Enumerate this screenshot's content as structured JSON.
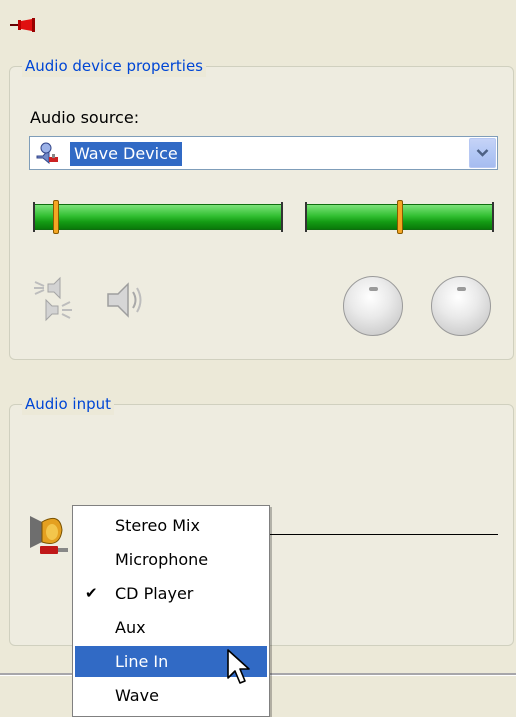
{
  "window": {
    "pin_icon": "pin-icon"
  },
  "properties": {
    "group_title": "Audio device properties",
    "source_label": "Audio source:",
    "source_value": "Wave Device",
    "source_icon": "audio-device-icon",
    "left_level": 0.08,
    "right_level": 0.5,
    "mute_icon": "speakers-icon",
    "volume_icon": "speaker-icon"
  },
  "input": {
    "group_title": "Audio input",
    "input_icon": "speaker-cable-icon"
  },
  "menu": {
    "items": [
      {
        "label": "Stereo Mix",
        "checked": false,
        "selected": false
      },
      {
        "label": "Microphone",
        "checked": false,
        "selected": false
      },
      {
        "label": "CD Player",
        "checked": true,
        "selected": false
      },
      {
        "label": "Aux",
        "checked": false,
        "selected": false
      },
      {
        "label": "Line In",
        "checked": false,
        "selected": true
      },
      {
        "label": "Wave",
        "checked": false,
        "selected": false
      }
    ]
  },
  "colors": {
    "background": "#ECE9D8",
    "group_title": "#0046D5",
    "selection": "#316AC5",
    "meter_green": "#33C033",
    "meter_thumb": "#F5A623"
  }
}
